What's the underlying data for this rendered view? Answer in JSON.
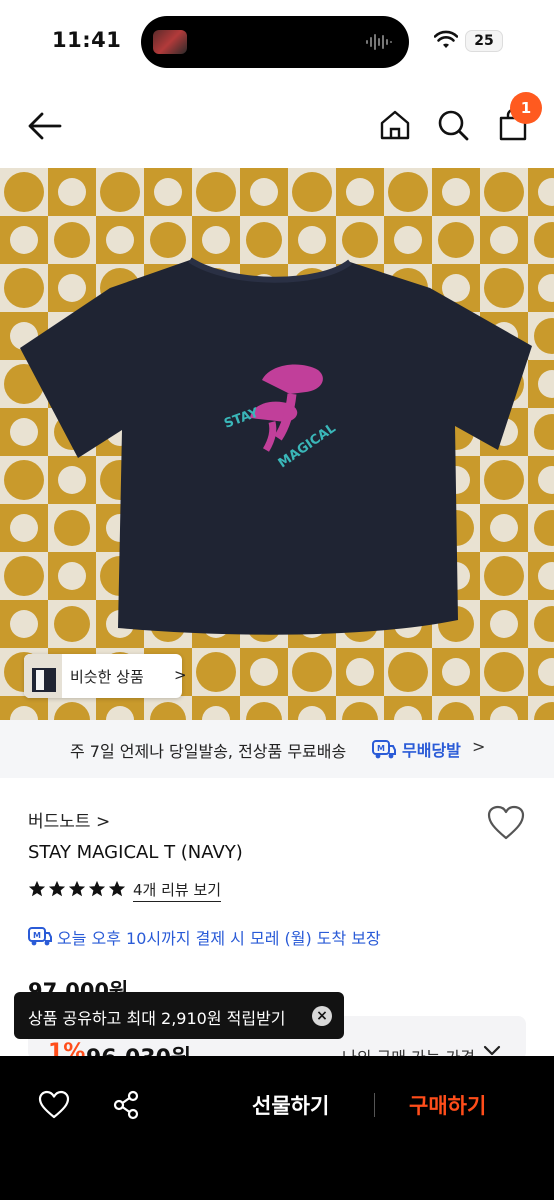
{
  "status_bar": {
    "time": "11:41",
    "battery": "25"
  },
  "header": {
    "cart_count": "1"
  },
  "hero": {
    "similar_label": "비슷한 상품",
    "similar_chevron": ">"
  },
  "delivery_banner": {
    "text": "주 7일 언제나 당일발송, 전상품 무료배송",
    "free_label": "무배당발",
    "chevron": ">"
  },
  "product": {
    "brand": "버드노트 >",
    "name": "STAY MAGICAL T (NAVY)",
    "rating_stars": 5,
    "review_link": "4개 리뷰 보기",
    "arrival_text": "오늘 오후 10시까지 결제 시 모레 (월) 도착 보장",
    "original_price": "97,000원",
    "discount_rate": "1%",
    "sale_price": "96,030원",
    "my_price_label": "나의 구매 가능 가격"
  },
  "toast": {
    "text": "상품 공유하고 최대 2,910원 적립받기",
    "close": "×"
  },
  "bottom_bar": {
    "gift_label": "선물하기",
    "buy_label": "구매하기"
  },
  "colors": {
    "accent": "#ff4d1a",
    "blue": "#2a5bd7",
    "badge": "#ff5a1f",
    "navy_shirt": "#1f2433"
  }
}
